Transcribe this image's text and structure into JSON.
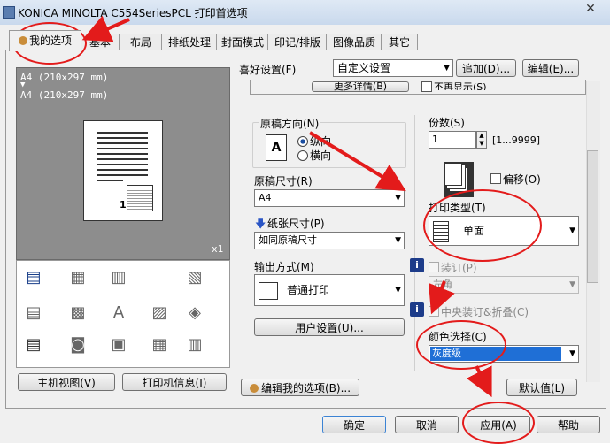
{
  "window": {
    "title": "KONICA MINOLTA C554SeriesPCL 打印首选项",
    "close_glyph": "✕"
  },
  "tabs": [
    {
      "label": "我的选项",
      "active": true
    },
    {
      "label": "基本"
    },
    {
      "label": "布局"
    },
    {
      "label": "排纸处理"
    },
    {
      "label": "封面模式"
    },
    {
      "label": "印记/排版"
    },
    {
      "label": "图像品质"
    },
    {
      "label": "其它"
    }
  ],
  "preview": {
    "line1": "A4  (210x297 mm)",
    "arrow": "▼",
    "line2": "A4  (210x297 mm)",
    "scale": "x1",
    "page_number": "1"
  },
  "favorites": {
    "label": "喜好设置(F)",
    "value": "自定义设置",
    "add_button": "追加(D)...",
    "edit_button": "编辑(E)..."
  },
  "details": {
    "more_button": "更多详情(B)",
    "no_show_label": "不再显示(S)"
  },
  "orientation": {
    "label": "原稿方向(N)",
    "portrait": "纵向",
    "landscape": "横向",
    "selected": "portrait"
  },
  "original_size": {
    "label": "原稿尺寸(R)",
    "value": "A4"
  },
  "paper_size": {
    "label": "纸张尺寸(P)",
    "value": "如同原稿尺寸"
  },
  "output_method": {
    "label": "输出方式(M)",
    "value": "普通打印"
  },
  "user_settings_button": "用户设置(U)...",
  "copies": {
    "label": "份数(S)",
    "value": "1",
    "range": "[1...9999]",
    "offset_label": "偏移(O)"
  },
  "print_type": {
    "label": "打印类型(T)",
    "value": "单面"
  },
  "binding": {
    "label": "装订(P)",
    "position": "左角"
  },
  "center_staple": {
    "label": "中央装订&折叠(C)"
  },
  "color_select": {
    "label": "颜色选择(C)",
    "value": "灰度级"
  },
  "bottom_left_buttons": {
    "host_view": "主机视图(V)",
    "printer_info": "打印机信息(I)"
  },
  "edit_my_options_button": "编辑我的选项(B)...",
  "defaults_button": "默认值(L)",
  "dialog_buttons": {
    "ok": "确定",
    "cancel": "取消",
    "apply": "应用(A)",
    "help": "帮助"
  },
  "info_badge": "i"
}
